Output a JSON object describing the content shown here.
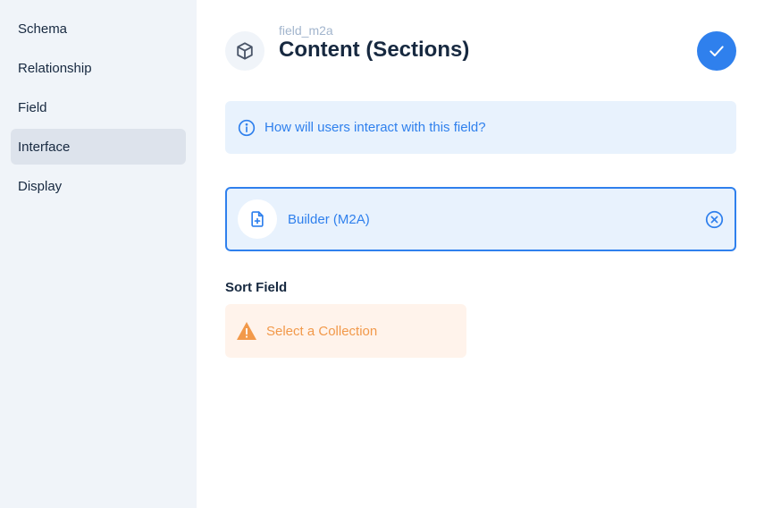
{
  "sidebar": {
    "items": [
      {
        "label": "Schema",
        "active": false
      },
      {
        "label": "Relationship",
        "active": false
      },
      {
        "label": "Field",
        "active": false
      },
      {
        "label": "Interface",
        "active": true
      },
      {
        "label": "Display",
        "active": false
      }
    ]
  },
  "header": {
    "subtitle": "field_m2a",
    "title": "Content (Sections)",
    "icon": "box-icon",
    "save_icon": "check-icon"
  },
  "notice": {
    "icon": "info-icon",
    "text": "How will users interact with this field?"
  },
  "selected_interface": {
    "icon": "file-plus-icon",
    "label": "Builder (M2A)",
    "deselect_icon": "close-circle-icon"
  },
  "sort_field": {
    "label": "Sort Field",
    "warning_icon": "warning-icon",
    "warning_text": "Select a Collection"
  },
  "colors": {
    "primary": "#2f80ed",
    "warning": "#f2994a",
    "sidebar_bg": "#f0f4f9",
    "text": "#172940",
    "subdued": "#a2b5cd"
  }
}
